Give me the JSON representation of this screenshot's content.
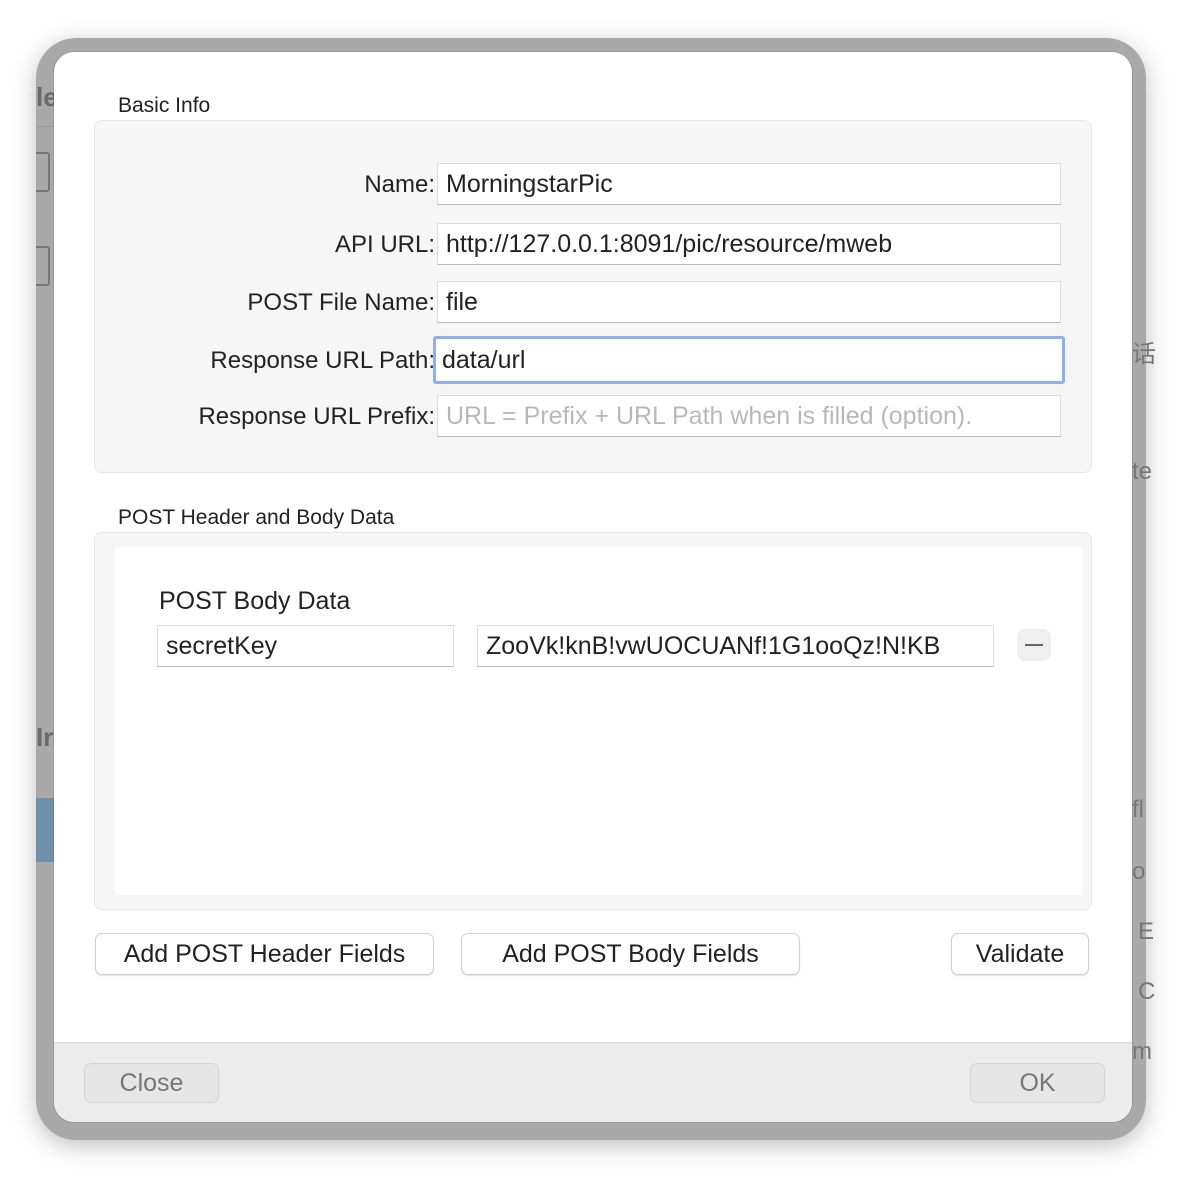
{
  "background_fragments": {
    "left": [
      "le",
      "Ir"
    ],
    "right": [
      "话",
      "te",
      "fl",
      "o",
      "E",
      "C",
      "m"
    ]
  },
  "basic_info": {
    "title": "Basic Info",
    "fields": [
      {
        "label": "Name:",
        "value": "MorningstarPic",
        "placeholder": ""
      },
      {
        "label": "API URL:",
        "value": "http://127.0.0.1:8091/pic/resource/mweb",
        "placeholder": ""
      },
      {
        "label": "POST File Name:",
        "value": "file",
        "placeholder": ""
      },
      {
        "label": "Response URL Path:",
        "value": "data/url",
        "placeholder": "",
        "focused": true
      },
      {
        "label": "Response URL Prefix:",
        "value": "",
        "placeholder": "URL = Prefix + URL Path when is filled (option)."
      }
    ]
  },
  "post_data": {
    "title": "POST Header and Body Data",
    "body_title": "POST Body Data",
    "body_rows": [
      {
        "key": "secretKey",
        "value": "ZooVk!knB!vwUOCUANf!1G1ooQz!N!KB",
        "remove_icon": "minus-icon"
      }
    ]
  },
  "buttons": {
    "add_header": "Add POST Header Fields",
    "add_body": "Add POST Body Fields",
    "validate": "Validate"
  },
  "footer": {
    "close": "Close",
    "ok": "OK"
  },
  "colors": {
    "focus_ring": "#8fb0ef"
  }
}
